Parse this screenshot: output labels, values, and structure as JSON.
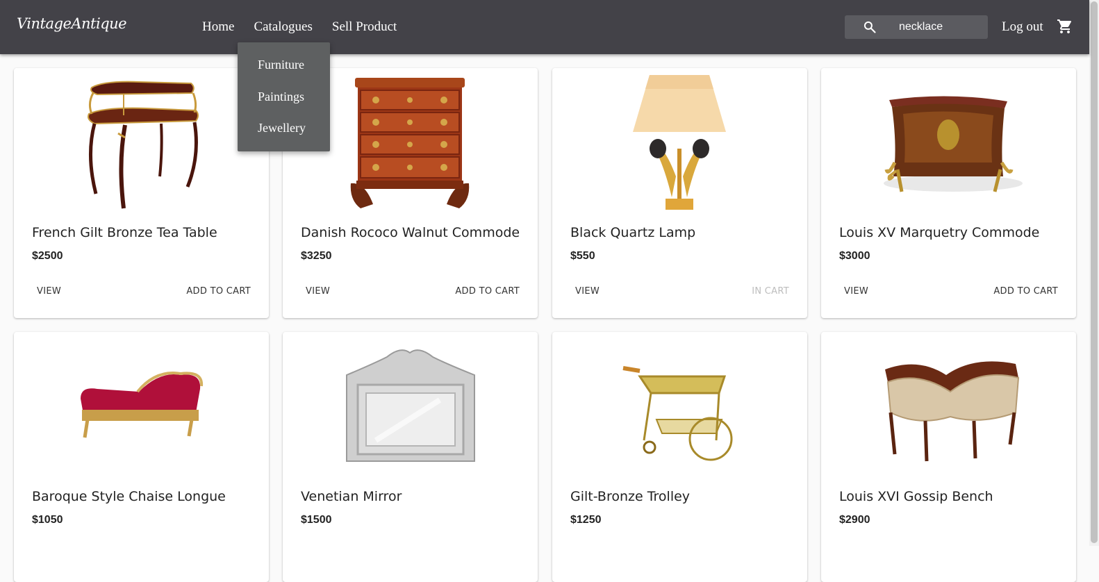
{
  "header": {
    "logo": "VintageAntique",
    "nav": [
      "Home",
      "Catalogues",
      "Sell Product"
    ],
    "search_value": "necklace",
    "logout": "Log out"
  },
  "dropdown": [
    "Furniture",
    "Paintings",
    "Jewellery"
  ],
  "products": [
    {
      "title": "French Gilt Bronze Tea Table",
      "price": "$2500",
      "view": "VIEW",
      "cart": "ADD TO CART",
      "in_cart": false
    },
    {
      "title": "Danish Rococo Walnut Commode",
      "price": "$3250",
      "view": "VIEW",
      "cart": "ADD TO CART",
      "in_cart": false
    },
    {
      "title": "Black Quartz Lamp",
      "price": "$550",
      "view": "VIEW",
      "cart": "IN CART",
      "in_cart": true
    },
    {
      "title": "Louis XV Marquetry Commode",
      "price": "$3000",
      "view": "VIEW",
      "cart": "ADD TO CART",
      "in_cart": false
    },
    {
      "title": "Baroque Style Chaise Longue",
      "price": "$1050"
    },
    {
      "title": "Venetian Mirror",
      "price": "$1500"
    },
    {
      "title": "Gilt-Bronze Trolley",
      "price": "$1250"
    },
    {
      "title": "Louis XVI Gossip Bench",
      "price": "$2900"
    }
  ],
  "colors": {
    "header_bg": "#434248",
    "dropdown_bg": "#5e6061"
  }
}
